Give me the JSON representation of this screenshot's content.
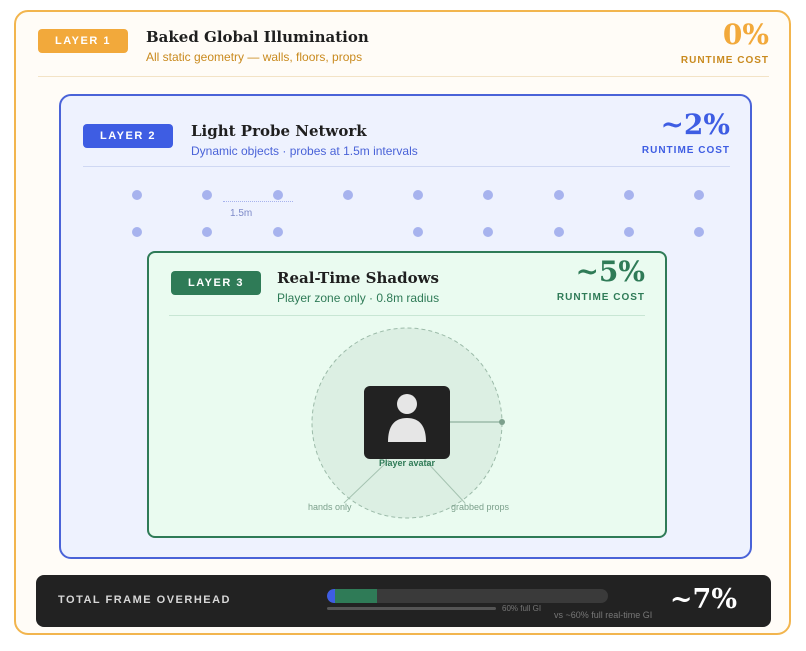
{
  "layer1": {
    "badge": "LAYER 1",
    "title": "Baked Global Illumination",
    "subtitle": "All static geometry — walls, floors, props",
    "cost_value": "0%",
    "cost_label": "RUNTIME COST",
    "color": "#f2a93b"
  },
  "layer2": {
    "badge": "LAYER 2",
    "title": "Light Probe Network",
    "subtitle": "Dynamic objects · probes at 1.5m intervals",
    "cost_value": "~2%",
    "cost_label": "RUNTIME COST",
    "spacing_label": "1.5m",
    "color": "#3e5de3"
  },
  "layer3": {
    "badge": "LAYER 3",
    "title": "Real-Time Shadows",
    "subtitle": "Player zone only · 0.8m radius",
    "cost_value": "~5%",
    "cost_label": "RUNTIME COST",
    "avatar_label": "Player avatar",
    "tag_hands": "hands only",
    "tag_props": "grabbed props",
    "avatar_icon": "person-icon",
    "color": "#2f7b57"
  },
  "footer": {
    "label": "TOTAL FRAME OVERHEAD",
    "bar_probe_percent": 2,
    "bar_shadow_percent": 5,
    "reference_percent": 60,
    "reference_label": "60% full GI",
    "comparison": "vs ~60% full real-time GI",
    "total_value": "~7%"
  }
}
